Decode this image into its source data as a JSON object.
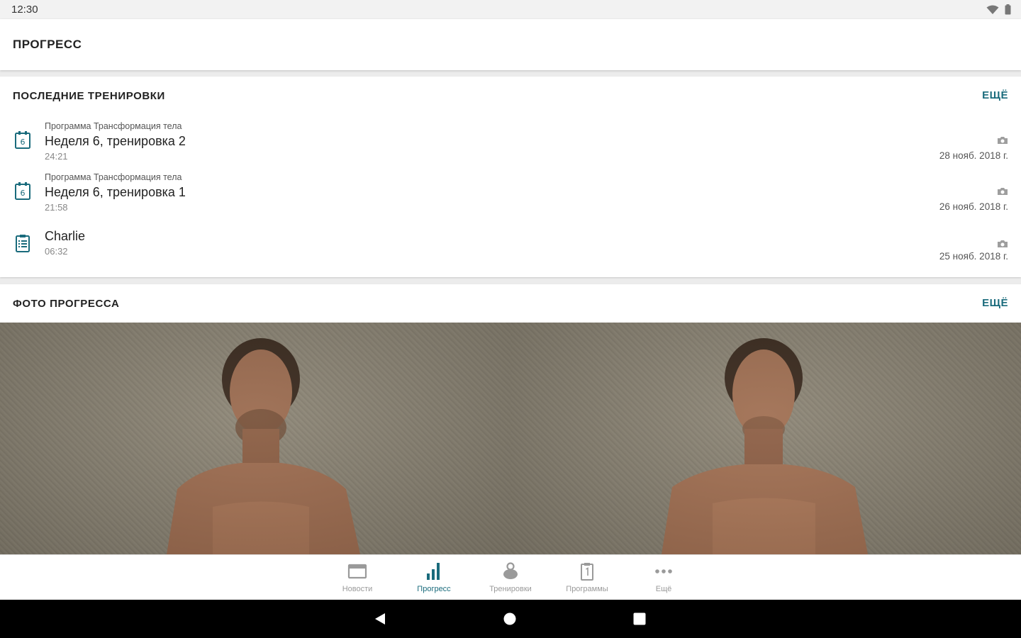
{
  "status_bar": {
    "time": "12:30"
  },
  "app_bar": {
    "title": "ПРОГРЕСС"
  },
  "recent_workouts": {
    "header": "ПОСЛЕДНИЕ ТРЕНИРОВКИ",
    "more_label": "ЕЩЁ",
    "items": [
      {
        "program": "Программа Трансформация тела",
        "title": "Неделя 6, тренировка 2",
        "duration": "24:21",
        "date": "28 нояб. 2018 г.",
        "icon": "calendar-day-6-icon",
        "day": "6"
      },
      {
        "program": "Программа Трансформация тела",
        "title": "Неделя 6, тренировка 1",
        "duration": "21:58",
        "date": "26 нояб. 2018 г.",
        "icon": "calendar-day-6-icon",
        "day": "6"
      },
      {
        "program": "",
        "title": "Charlie",
        "duration": "06:32",
        "date": "25 нояб. 2018 г.",
        "icon": "clipboard-list-icon"
      }
    ]
  },
  "progress_photos": {
    "header": "ФОТО ПРОГРЕССА",
    "more_label": "ЕЩЁ"
  },
  "bottom_nav": {
    "active": "progress",
    "items": [
      {
        "key": "news",
        "label": "Новости",
        "icon": "news-icon"
      },
      {
        "key": "progress",
        "label": "Прогресс",
        "icon": "bar-chart-icon"
      },
      {
        "key": "workouts",
        "label": "Тренировки",
        "icon": "kettlebell-icon"
      },
      {
        "key": "programs",
        "label": "Программы",
        "icon": "calendar-program-icon"
      },
      {
        "key": "more",
        "label": "Ещё",
        "icon": "more-dots-icon"
      }
    ]
  },
  "colors": {
    "accent": "#1a6b7c",
    "inactive": "#9a9a9a",
    "system_nav": "#000000"
  }
}
